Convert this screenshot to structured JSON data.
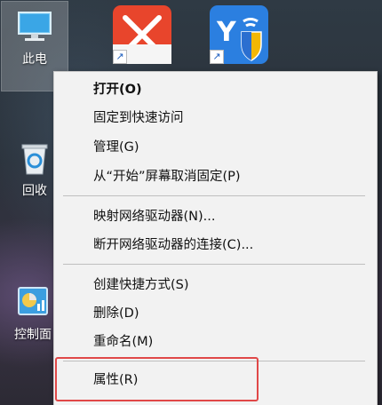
{
  "desktop": {
    "icons": [
      {
        "label": "此电",
        "icon": "computer-icon"
      },
      {
        "label": "回收",
        "icon": "recycle-bin-icon"
      },
      {
        "label": "控制面",
        "icon": "control-panel-icon"
      }
    ],
    "shortcuts": [
      {
        "icon": "red-x-app-icon",
        "color": "#e8452c"
      },
      {
        "icon": "shield-network-app-icon",
        "color": "#2b7fe0"
      }
    ]
  },
  "context_menu": {
    "items": [
      {
        "label": "打开(O)",
        "bold": true
      },
      {
        "label": "固定到快速访问"
      },
      {
        "label": "管理(G)"
      },
      {
        "label": "从“开始”屏幕取消固定(P)"
      },
      {
        "label": "映射网络驱动器(N)..."
      },
      {
        "label": "断开网络驱动器的连接(C)..."
      },
      {
        "label": "创建快捷方式(S)"
      },
      {
        "label": "删除(D)"
      },
      {
        "label": "重命名(M)"
      },
      {
        "label": "属性(R)",
        "highlighted": true
      }
    ],
    "highlight_color": "#e04848"
  }
}
